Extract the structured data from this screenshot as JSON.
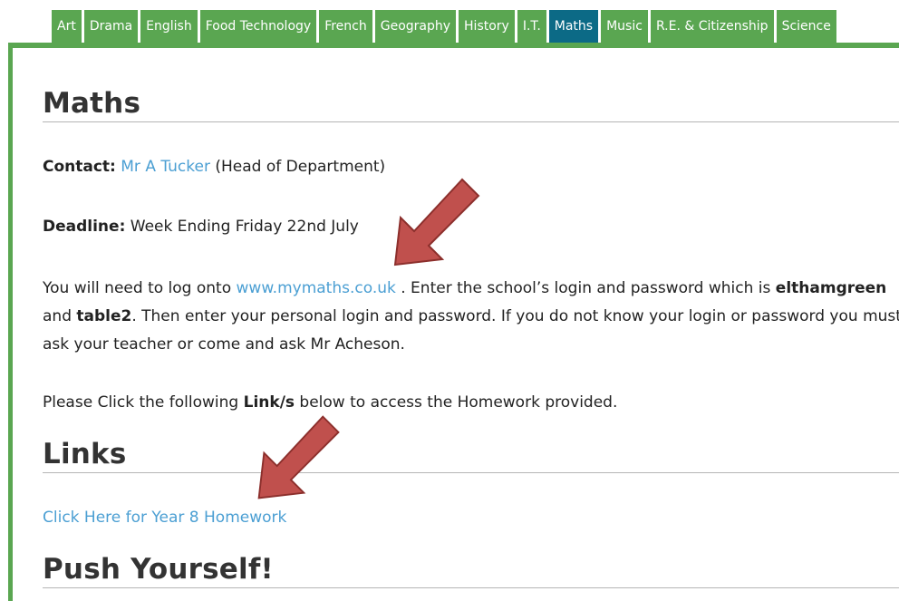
{
  "tabs": [
    {
      "label": "Art",
      "active": false
    },
    {
      "label": "Drama",
      "active": false
    },
    {
      "label": "English",
      "active": false
    },
    {
      "label": "Food Technology",
      "active": false
    },
    {
      "label": "French",
      "active": false
    },
    {
      "label": "Geography",
      "active": false
    },
    {
      "label": "History",
      "active": false
    },
    {
      "label": "I.T.",
      "active": false
    },
    {
      "label": "Maths",
      "active": true
    },
    {
      "label": "Music",
      "active": false
    },
    {
      "label": "R.E. & Citizenship",
      "active": false
    },
    {
      "label": "Science",
      "active": false
    }
  ],
  "page_title": "Maths",
  "contact": {
    "label": "Contact:",
    "name": "Mr A Tucker",
    "role": "(Head of Department)"
  },
  "deadline": {
    "label": "Deadline:",
    "value": "Week Ending Friday 22nd July"
  },
  "instructions": {
    "t1": "You will need to log onto ",
    "site": "www.mymaths.co.uk",
    "t2": " . Enter the school’s login and password which is ",
    "login": "elthamgreen",
    "t3": " and ",
    "password": "table2",
    "t4": ". Then enter your personal login and password. If you do not know your login or password you must ask your teacher or come and ask Mr Acheson."
  },
  "click_prompt": {
    "t1": "Please Click the following ",
    "bold": "Link/s",
    "t2": " below to access the Homework provided."
  },
  "links_heading": "Links",
  "homework_link": "Click Here for Year 8 Homework",
  "push_heading": "Push Yourself!",
  "colors": {
    "tab_green": "#5aa651",
    "tab_active": "#0c6a86",
    "link_blue": "#4b9fd3",
    "arrow_red": "#c0504d"
  }
}
